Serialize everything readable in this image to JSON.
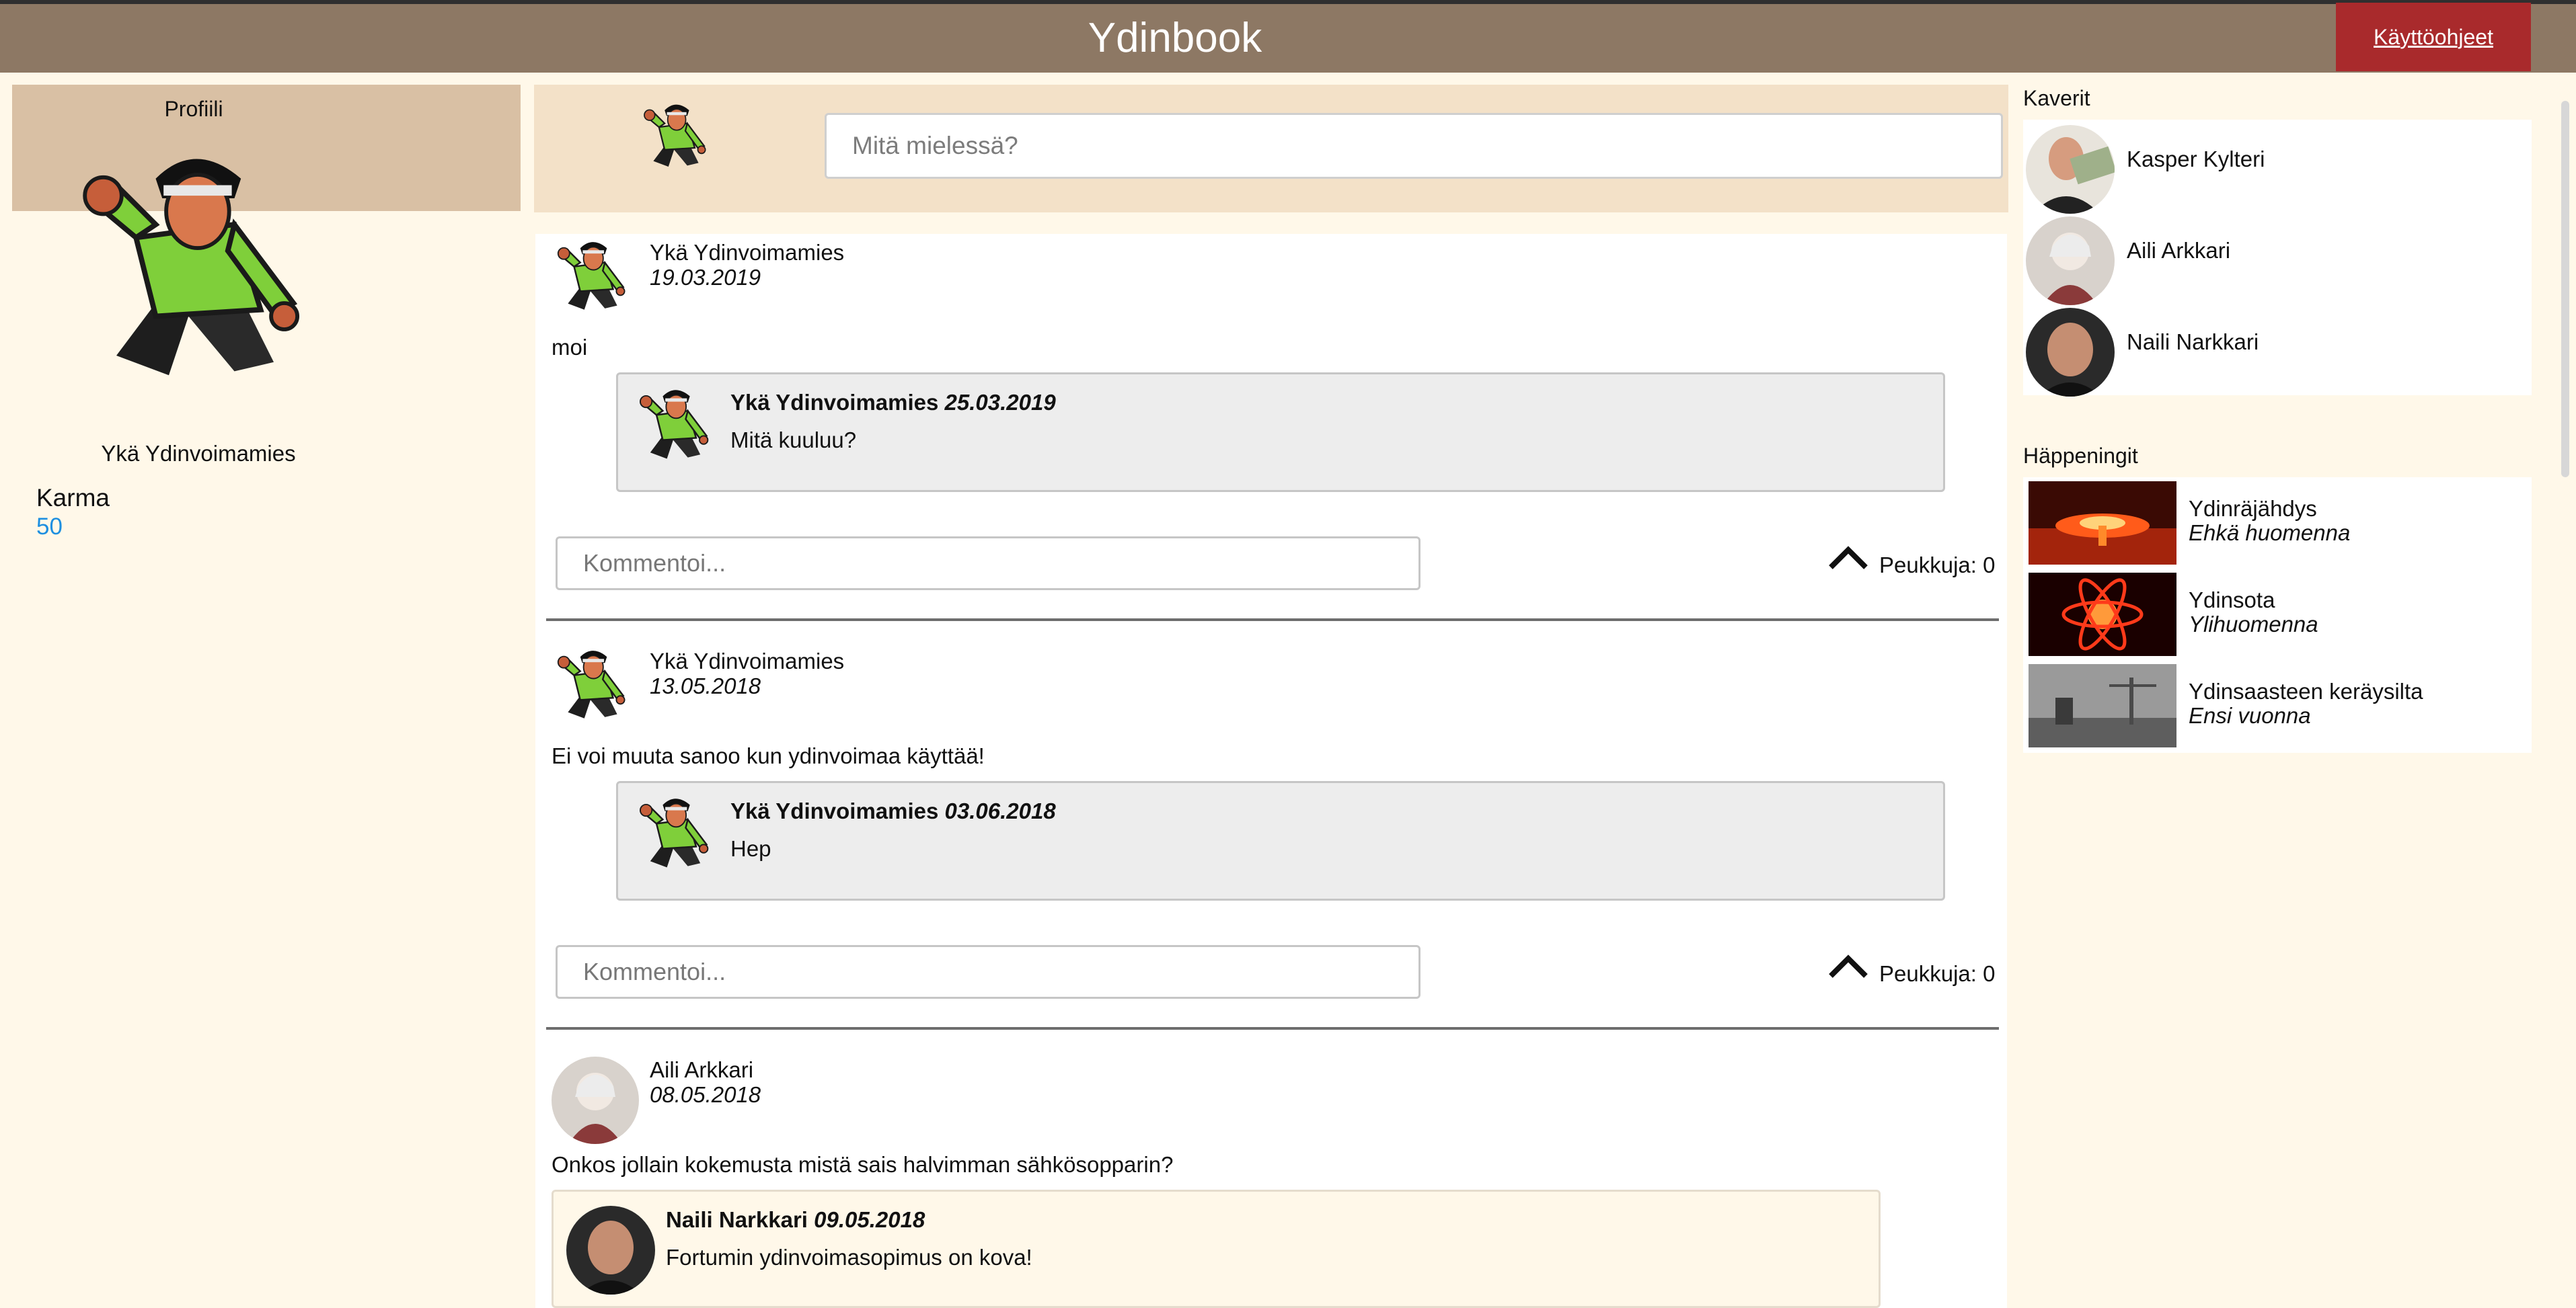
{
  "app": {
    "title": "Ydinbook",
    "help_label": "Käyttöohjeet"
  },
  "profile": {
    "title": "Profiili",
    "name": "Ykä Ydinvoimamies",
    "karma_label": "Karma",
    "karma_value": "50"
  },
  "composer": {
    "placeholder": "Mitä mielessä?"
  },
  "posts": [
    {
      "author": "Ykä Ydinvoimamies",
      "date": "19.03.2019",
      "text": "moi",
      "comment": {
        "author": "Ykä Ydinvoimamies",
        "date": "25.03.2019",
        "text": "Mitä kuuluu?"
      },
      "comment_placeholder": "Kommentoi...",
      "likes": "Peukkuja: 0"
    },
    {
      "author": "Ykä Ydinvoimamies",
      "date": "13.05.2018",
      "text": "Ei voi muuta sanoo kun ydinvoimaa käyttää!",
      "comment": {
        "author": "Ykä Ydinvoimamies",
        "date": "03.06.2018",
        "text": "Hep"
      },
      "comment_placeholder": "Kommentoi...",
      "likes": "Peukkuja: 0"
    },
    {
      "author": "Aili Arkkari",
      "date": "08.05.2018",
      "text": "Onkos jollain kokemusta mistä sais halvimman sähkösopparin?",
      "comment": {
        "author": "Naili Narkkari",
        "date": "09.05.2018",
        "text": "Fortumin ydinvoimasopimus on kova!"
      }
    }
  ],
  "friends": {
    "title": "Kaverit",
    "items": [
      {
        "name": "Kasper Kylteri"
      },
      {
        "name": "Aili Arkkari"
      },
      {
        "name": "Naili Narkkari"
      }
    ]
  },
  "events": {
    "title": "Häppeningit",
    "items": [
      {
        "name": "Ydinräjähdys",
        "when": "Ehkä huomenna"
      },
      {
        "name": "Ydinsota",
        "when": "Ylihuomenna"
      },
      {
        "name": "Ydinsaasteen keräysilta",
        "when": "Ensi vuonna"
      }
    ]
  },
  "colors": {
    "header": "#8d7864",
    "help_button": "#a92a2c",
    "karma": "#1d8fe0",
    "page_bg": "#fff8e9",
    "profile_bg": "#d9c0a4",
    "composer_bg": "#f3e1c8"
  }
}
